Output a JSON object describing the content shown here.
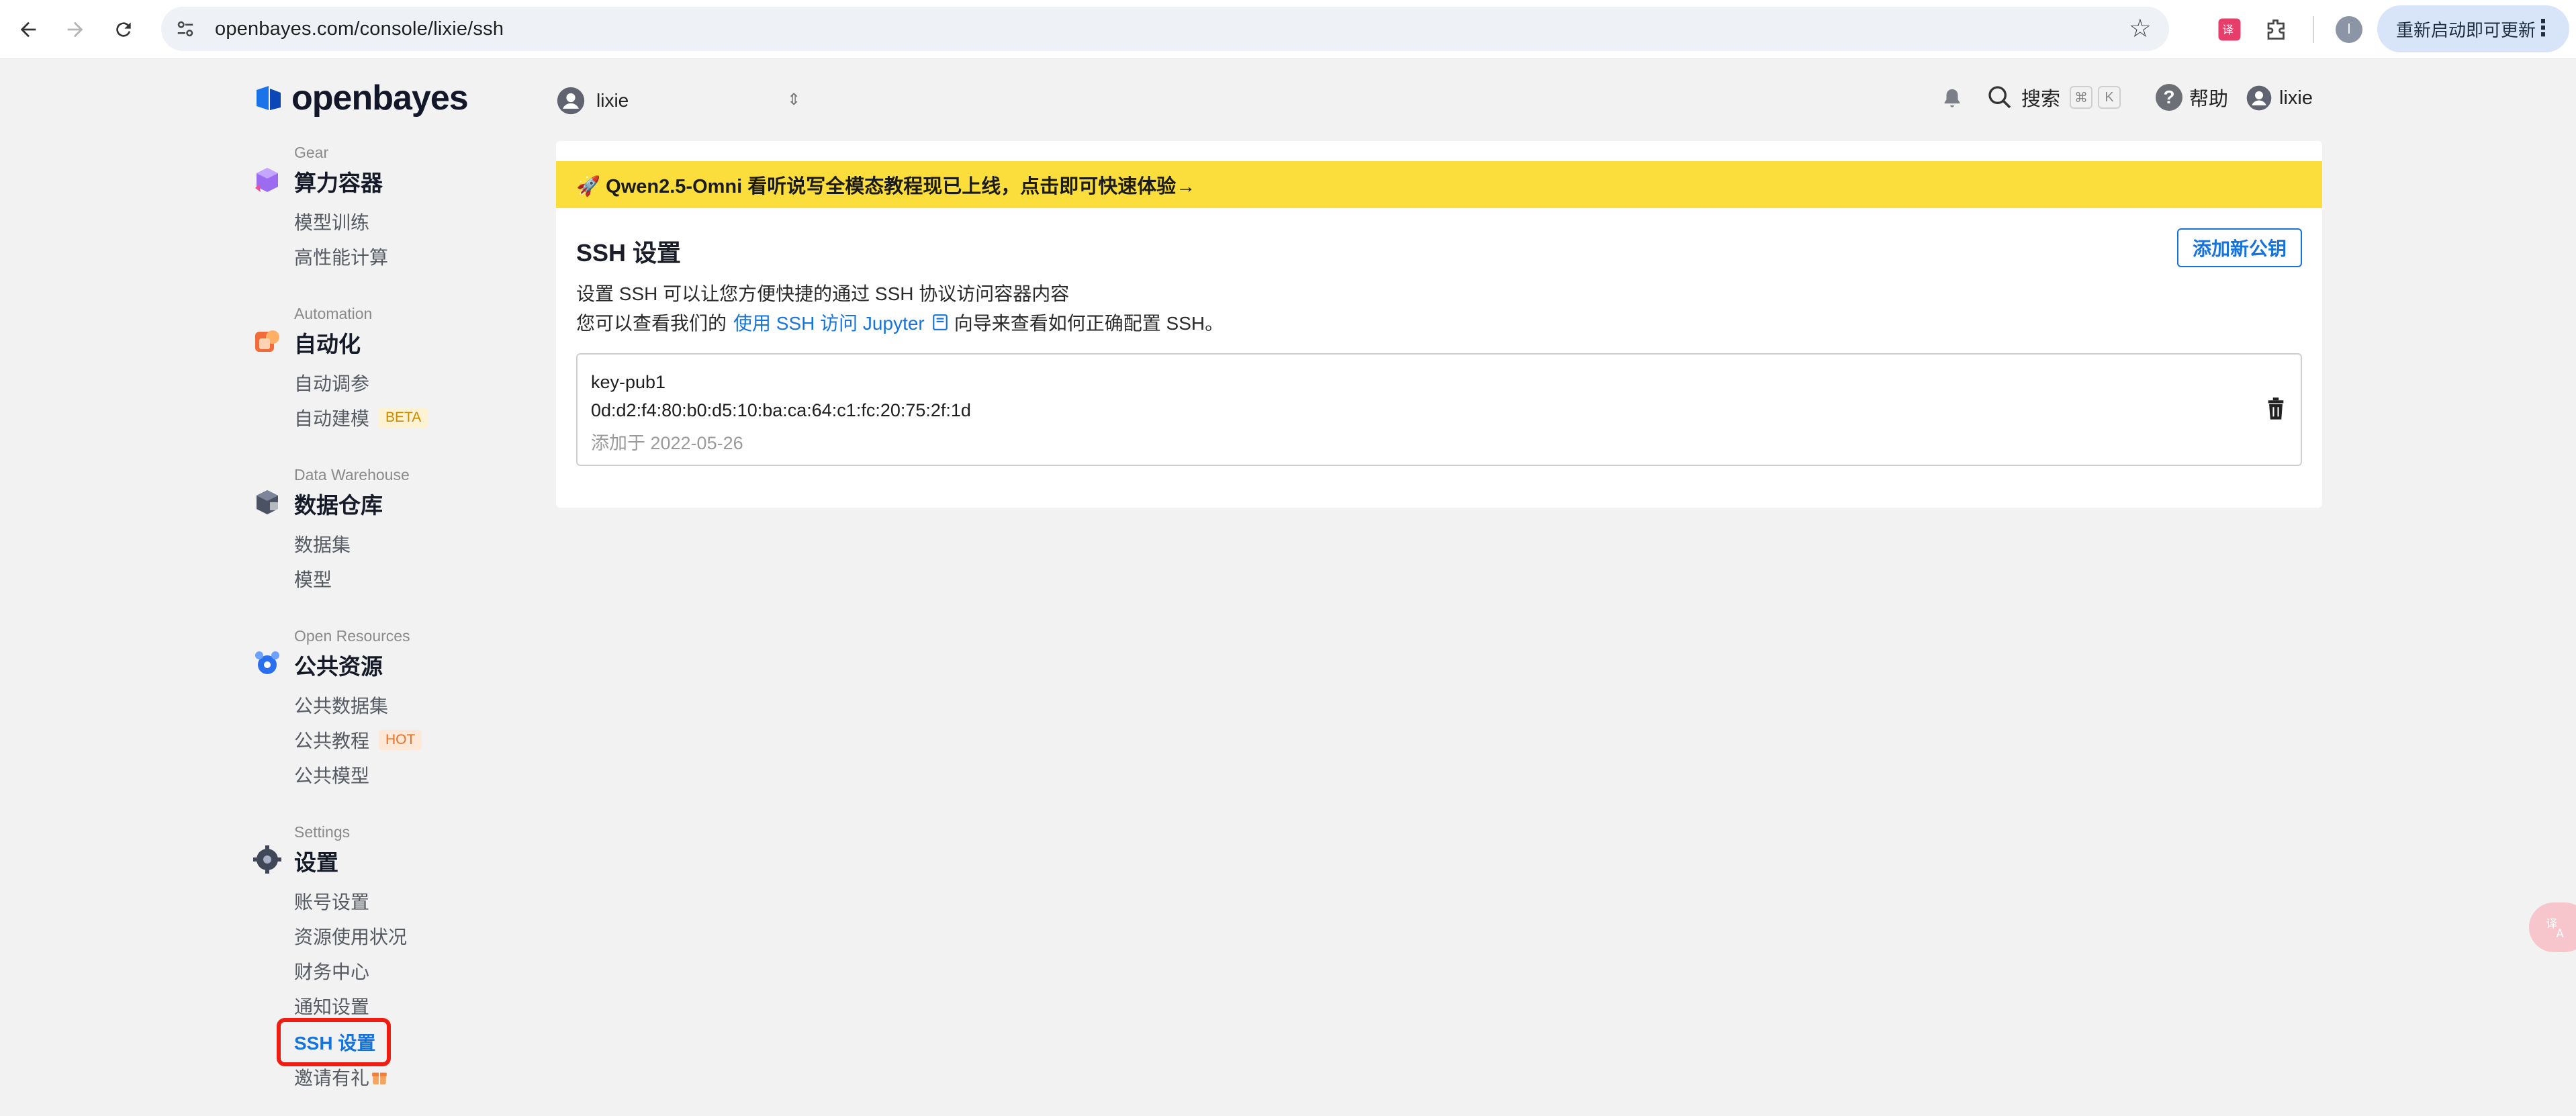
{
  "browser": {
    "url": "openbayes.com/console/lixie/ssh",
    "profile_initial": "l",
    "update_label": "重新启动即可更新"
  },
  "brand": {
    "logo_text": "openbayes"
  },
  "sidebar": {
    "sections": [
      {
        "en": "Gear",
        "title": "算力容器",
        "items": [
          "模型训练",
          "高性能计算"
        ]
      },
      {
        "en": "Automation",
        "title": "自动化",
        "items": [
          "自动调参",
          "自动建模"
        ],
        "badge": "BETA"
      },
      {
        "en": "Data Warehouse",
        "title": "数据仓库",
        "items": [
          "数据集",
          "模型"
        ]
      },
      {
        "en": "Open Resources",
        "title": "公共资源",
        "items": [
          "公共数据集",
          "公共教程",
          "公共模型"
        ],
        "badge": "HOT"
      },
      {
        "en": "Settings",
        "title": "设置",
        "items": [
          "账号设置",
          "资源使用状况",
          "财务中心",
          "通知设置",
          "SSH 设置",
          "邀请有礼"
        ]
      }
    ],
    "active_item": "SSH 设置"
  },
  "topbar": {
    "workspace_user": "lixie",
    "search_label": "搜索",
    "kbd_cmd": "⌘",
    "kbd_k": "K",
    "help_label": "帮助",
    "user_label": "lixie"
  },
  "banner": {
    "text": "🚀 Qwen2.5-Omni 看听说写全模态教程现已上线，点击即可快速体验→"
  },
  "ssh": {
    "title": "SSH 设置",
    "add_button": "添加新公钥",
    "desc_line1": "设置 SSH 可以让您方便快捷的通过 SSH 协议访问容器内容",
    "desc_line2_prefix": "您可以查看我们的",
    "desc_link": "使用 SSH 访问 Jupyter",
    "desc_line2_suffix": "向导来查看如何正确配置 SSH。",
    "keys": [
      {
        "name": "key-pub1",
        "fingerprint": "0d:d2:f4:80:b0:d5:10:ba:ca:64:c1:fc:20:75:2f:1d",
        "added": "添加于 2022-05-26"
      }
    ]
  },
  "icons": {
    "accent": "#1673dc",
    "banner_bg": "#fbde3b",
    "highlight": "#ef1c11"
  }
}
